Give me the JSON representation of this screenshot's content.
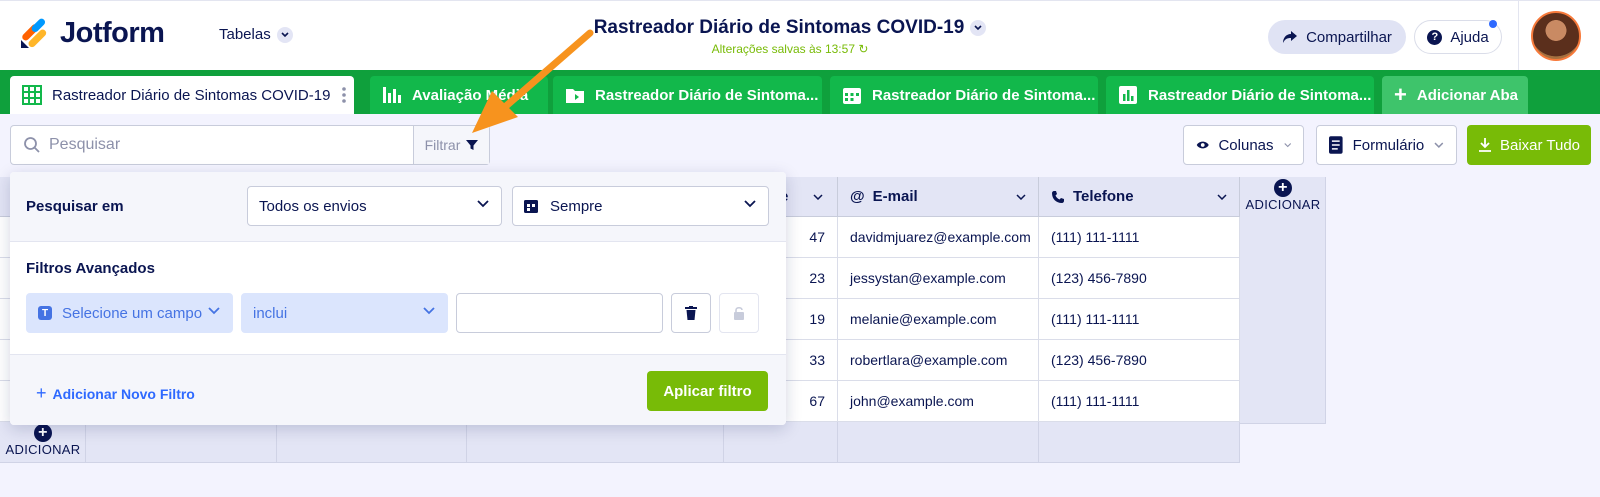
{
  "header": {
    "brand": "Jotform",
    "tables_menu": "Tabelas",
    "doc_title": "Rastreador Diário de Sintomas COVID-19",
    "saved_status": "Alterações salvas às 13:57",
    "share_label": "Compartilhar",
    "help_label": "Ajuda"
  },
  "tabs": [
    {
      "label": "Rastreador Diário de Sintomas COVID-19",
      "icon": "table-icon",
      "active": true
    },
    {
      "label": "Avaliação Média",
      "icon": "report-icon",
      "active": false
    },
    {
      "label": "Rastreador Diário de Sintoma...",
      "icon": "folder-icon",
      "active": false
    },
    {
      "label": "Rastreador Diário de Sintoma...",
      "icon": "calendar-icon",
      "active": false
    },
    {
      "label": "Rastreador Diário de Sintoma...",
      "icon": "chart-icon",
      "active": false
    },
    {
      "label": "Adicionar Aba",
      "icon": "plus-icon",
      "active": false
    }
  ],
  "toolbar": {
    "search_placeholder": "Pesquisar",
    "filter_label": "Filtrar",
    "columns_label": "Colunas",
    "form_label": "Formulário",
    "download_label": "Baixar Tudo"
  },
  "table": {
    "partial_header": "e",
    "columns": [
      "E-mail",
      "Telefone"
    ],
    "add_label": "ADICIONAR",
    "rows": [
      {
        "age": "47",
        "email": "davidmjuarez@example.com",
        "phone": "(111) 111-1111"
      },
      {
        "age": "23",
        "email": "jessystan@example.com",
        "phone": "(123) 456-7890"
      },
      {
        "age": "19",
        "email": "melanie@example.com",
        "phone": "(111) 111-1111"
      },
      {
        "age": "33",
        "email": "robertlara@example.com",
        "phone": "(123) 456-7890"
      },
      {
        "age": "67",
        "email": "john@example.com",
        "phone": "(111) 111-1111"
      }
    ]
  },
  "filter_panel": {
    "search_in_label": "Pesquisar em",
    "scope_value": "Todos os envios",
    "date_value": "Sempre",
    "advanced_label": "Filtros Avançados",
    "field_placeholder": "Selecione um campo",
    "operator_value": "inclui",
    "value_input": "",
    "add_filter_label": "Adicionar Novo Filtro",
    "apply_label": "Aplicar filtro"
  },
  "colors": {
    "brand_green": "#0fa03c",
    "action_green": "#78bb07",
    "navy": "#0a1551",
    "link_blue": "#2e69ff",
    "annotation_orange": "#f7931e"
  }
}
